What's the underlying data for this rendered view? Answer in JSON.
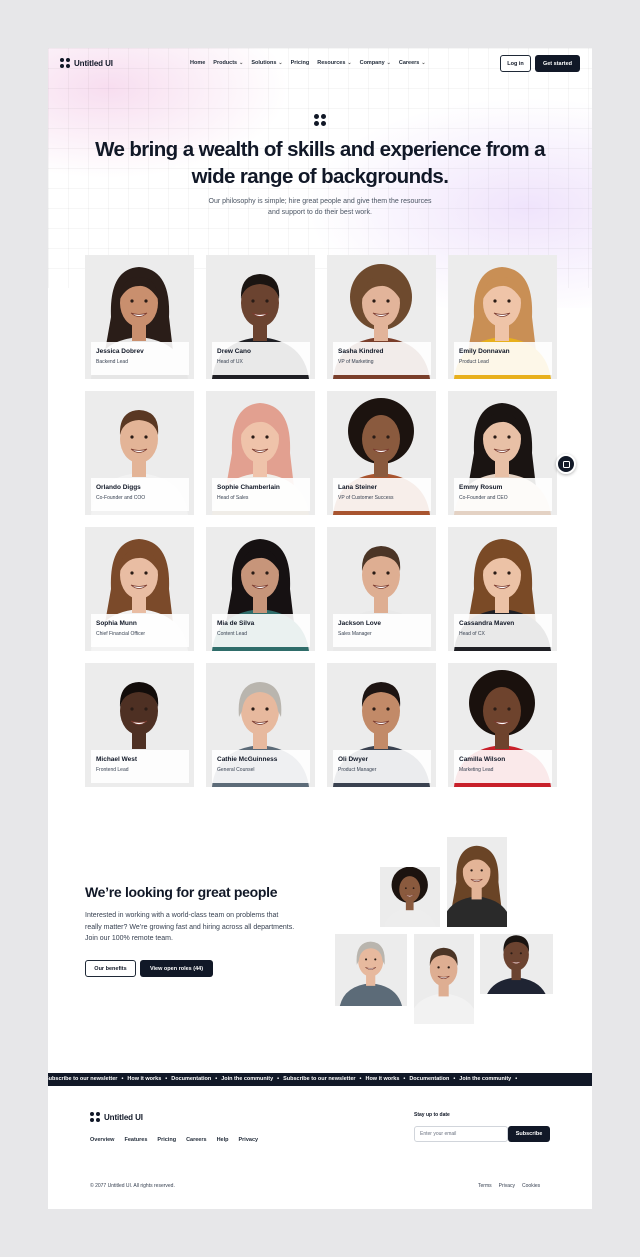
{
  "brand": {
    "name": "Untitled UI"
  },
  "nav": {
    "items": [
      {
        "label": "Home",
        "dropdown": false
      },
      {
        "label": "Products",
        "dropdown": true
      },
      {
        "label": "Solutions",
        "dropdown": true
      },
      {
        "label": "Pricing",
        "dropdown": false
      },
      {
        "label": "Resources",
        "dropdown": true
      },
      {
        "label": "Company",
        "dropdown": true
      },
      {
        "label": "Careers",
        "dropdown": true
      }
    ],
    "login_label": "Log in",
    "cta_label": "Get started"
  },
  "hero": {
    "title": "We bring a wealth of skills and experience from a wide range of backgrounds.",
    "subtitle": "Our philosophy is simple; hire great people and give them the resources and support to do their best work."
  },
  "team": [
    {
      "name": "Jessica Dobrev",
      "role": "Backend Lead",
      "skin": "#c98f6e",
      "hair": "#2a1d18",
      "shirt": "#e6e6e6",
      "hair_style": "long"
    },
    {
      "name": "Drew Cano",
      "role": "Head of UX",
      "skin": "#6b4330",
      "hair": "#1a1411",
      "shirt": "#1f1f24",
      "hair_style": "short"
    },
    {
      "name": "Sasha Kindred",
      "role": "VP of Marketing",
      "skin": "#e2b49a",
      "hair": "#6e4a2e",
      "shirt": "#7a3e2a",
      "hair_style": "curly"
    },
    {
      "name": "Emily Donnavan",
      "role": "Product Lead",
      "skin": "#efc4a8",
      "hair": "#c98f55",
      "shirt": "#e8b01c",
      "hair_style": "long"
    },
    {
      "name": "Orlando Diggs",
      "role": "Co-Founder and COO",
      "skin": "#e3b497",
      "hair": "#5a3823",
      "shirt": "#f2f2f2",
      "hair_style": "short"
    },
    {
      "name": "Sophie Chamberlain",
      "role": "Head of Sales",
      "skin": "#efc3aa",
      "hair": "#e2a090",
      "shirt": "#f0ede8",
      "hair_style": "long"
    },
    {
      "name": "Lana Steiner",
      "role": "VP of Customer Success",
      "skin": "#8a5a3e",
      "hair": "#1c130f",
      "shirt": "#a8542f",
      "hair_style": "afro"
    },
    {
      "name": "Emmy Rosum",
      "role": "Co-Founder and CEO",
      "skin": "#e8c0a6",
      "hair": "#1a1412",
      "shirt": "#e4d2c4",
      "hair_style": "long"
    },
    {
      "name": "Sophia Munn",
      "role": "Chief Financial Officer",
      "skin": "#e9bda3",
      "hair": "#7b4a2a",
      "shirt": "#f3f3f3",
      "hair_style": "long"
    },
    {
      "name": "Mia de Silva",
      "role": "Content Lead",
      "skin": "#c7957a",
      "hair": "#161112",
      "shirt": "#2f6d6a",
      "hair_style": "long"
    },
    {
      "name": "Jackson Love",
      "role": "Sales Manager",
      "skin": "#deae92",
      "hair": "#4b3526",
      "shirt": "#e9e9e9",
      "hair_style": "short"
    },
    {
      "name": "Cassandra Maven",
      "role": "Head of CX",
      "skin": "#ecc2a6",
      "hair": "#7a4a26",
      "shirt": "#1f1f24",
      "hair_style": "long"
    },
    {
      "name": "Michael West",
      "role": "Frontend Lead",
      "skin": "#4e3023",
      "hair": "#120c0a",
      "shirt": "#ececec",
      "hair_style": "short"
    },
    {
      "name": "Cathie McGuinness",
      "role": "General Counsel",
      "skin": "#e7b99e",
      "hair": "#b9b5ae",
      "shirt": "#5c6b78",
      "hair_style": "bob"
    },
    {
      "name": "Oli Dwyer",
      "role": "Product Manager",
      "skin": "#c28a68",
      "hair": "#1d1412",
      "shirt": "#3a4250",
      "hair_style": "short"
    },
    {
      "name": "Camilla Wilson",
      "role": "Marketing Lead",
      "skin": "#6e432d",
      "hair": "#1a110d",
      "shirt": "#c8202a",
      "hair_style": "afro"
    }
  ],
  "hiring": {
    "title": "We’re looking for great people",
    "text": "Interested in working with a world-class team on problems that really matter? We’re growing fast and hiring across all departments. Join our 100% remote team.",
    "benefits_label": "Our benefits",
    "roles_label": "View open roles (44)",
    "gallery": [
      {
        "skin": "#8a5a3e",
        "hair": "#1c130f",
        "shirt": "#ededed",
        "hair_style": "afro"
      },
      {
        "skin": "#e3b497",
        "hair": "#6a4426",
        "shirt": "#2a2a2a",
        "hair_style": "long"
      },
      {
        "skin": "#e7b99e",
        "hair": "#b9b5ae",
        "shirt": "#5c6b78",
        "hair_style": "bob"
      },
      {
        "skin": "#deae92",
        "hair": "#4b3526",
        "shirt": "#f2f2f2",
        "hair_style": "short"
      },
      {
        "skin": "#6b4330",
        "hair": "#1a1411",
        "shirt": "#1f2433",
        "hair_style": "short"
      }
    ]
  },
  "ticker": {
    "items": [
      "Subscribe to our newsletter",
      "How it works",
      "Documentation",
      "Join the community",
      "Subscribe to our newsletter",
      "How it works",
      "Documentation",
      "Join the community"
    ],
    "separator": "•"
  },
  "footer": {
    "links": [
      "Overview",
      "Features",
      "Pricing",
      "Careers",
      "Help",
      "Privacy"
    ],
    "newsletter_heading": "Stay up to date",
    "email_placeholder": "Enter your email",
    "subscribe_label": "Subscribe",
    "copyright": "© 2077 Untitled UI. All rights reserved.",
    "legal": [
      "Terms",
      "Privacy",
      "Cookies"
    ]
  },
  "colors": {
    "accent": "#111827",
    "card_bg": "#ececec",
    "page_bg": "#e7e7e9"
  }
}
